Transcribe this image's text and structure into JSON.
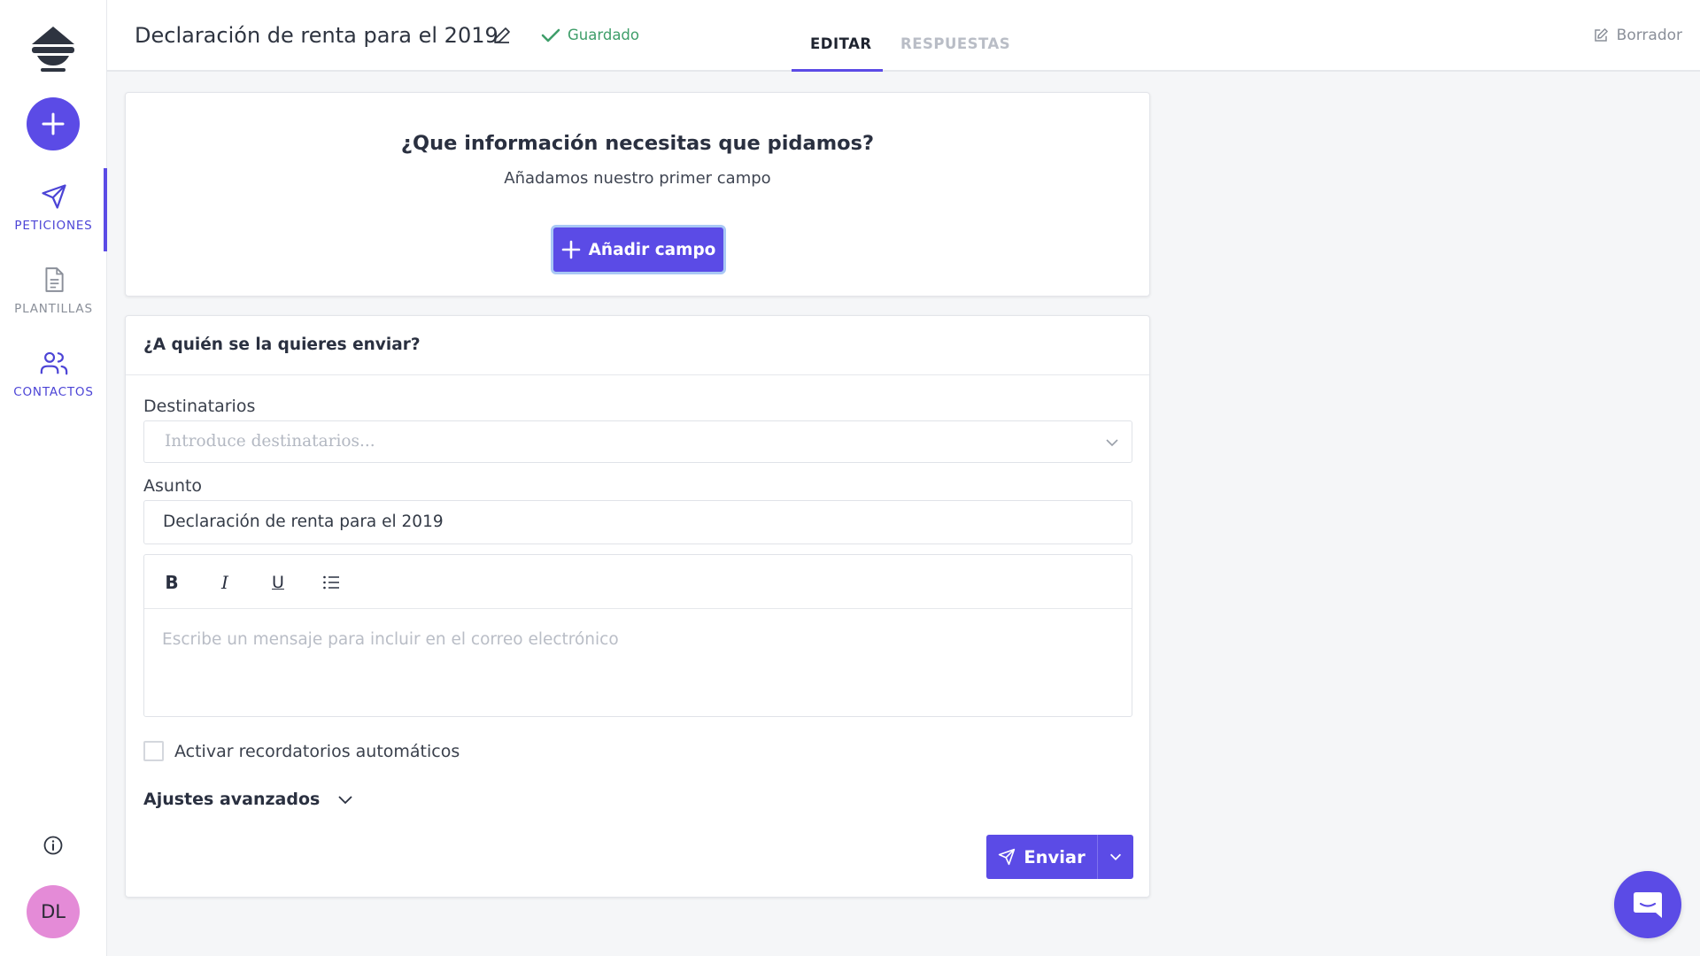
{
  "app": {
    "logo_icon": "stack-logo-icon",
    "accent_color": "#5b4be6"
  },
  "sidebar": {
    "new_button_icon": "plus-icon",
    "items": [
      {
        "label": "PETICIONES",
        "icon": "send-plane-icon",
        "active": true
      },
      {
        "label": "PLANTILLAS",
        "icon": "document-icon",
        "active": false
      },
      {
        "label": "CONTACTOS",
        "icon": "users-icon",
        "active": false
      }
    ],
    "info_icon": "info-icon",
    "avatar_initials": "DL"
  },
  "header": {
    "title": "Declaración de renta para el 2019",
    "saved_status": "Guardado",
    "tabs": [
      {
        "label": "EDITAR",
        "active": true
      },
      {
        "label": "RESPUESTAS",
        "active": false
      }
    ],
    "draft_label": "Borrador"
  },
  "fields_card": {
    "title": "¿Que información necesitas que pidamos?",
    "subtitle": "Añadamos nuestro primer campo",
    "add_button": "Añadir campo"
  },
  "send_card": {
    "title": "¿A quién se la quieres enviar?",
    "recipients_label": "Destinatarios",
    "recipients_placeholder": "Introduce destinatarios...",
    "subject_label": "Asunto",
    "subject_value": "Declaración de renta para el 2019",
    "toolbar": {
      "bold": "B",
      "italic": "I",
      "underline": "U"
    },
    "message_placeholder": "Escribe un mensaje para incluir en el correo electrónico",
    "reminders_label": "Activar recordatorios automáticos",
    "reminders_checked": false,
    "advanced_label": "Ajustes avanzados",
    "send_button": "Enviar"
  },
  "chat_widget_icon": "chat-bubble-icon"
}
